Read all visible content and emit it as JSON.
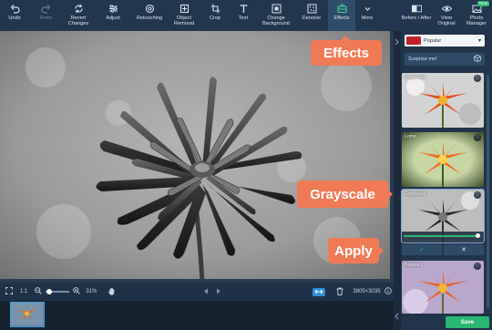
{
  "toolbar": {
    "items": [
      {
        "label": "Undo",
        "icon": "undo-icon"
      },
      {
        "label": "Redo",
        "icon": "redo-icon"
      },
      {
        "label": "Revert Changes",
        "icon": "revert-icon"
      },
      {
        "label": "Adjust",
        "icon": "sliders-icon"
      },
      {
        "label": "Retouching",
        "icon": "retouch-icon"
      },
      {
        "label": "Object Removal",
        "icon": "eraser-icon"
      },
      {
        "label": "Crop",
        "icon": "crop-icon"
      },
      {
        "label": "Text",
        "icon": "text-icon"
      },
      {
        "label": "Change Background",
        "icon": "background-icon"
      },
      {
        "label": "Denoise",
        "icon": "denoise-icon"
      },
      {
        "label": "Effects",
        "icon": "effects-icon"
      },
      {
        "label": "More",
        "icon": "chevron-down-icon"
      }
    ],
    "right_items": [
      {
        "label": "Before / After",
        "icon": "compare-icon"
      },
      {
        "label": "View Original",
        "icon": "eye-icon"
      },
      {
        "label": "Photo Manager",
        "icon": "photo-manager-icon",
        "badge": "New"
      }
    ]
  },
  "bottombar": {
    "ratio": "1:1",
    "zoom": "31%",
    "dimensions": "3805×3035",
    "zoom_level": 0.05
  },
  "panel": {
    "preset_dropdown": "Popular",
    "surprise_label": "Surprise me!",
    "effects": [
      {
        "name": "Grayscale"
      },
      {
        "name": "Lomo"
      },
      {
        "name": "Grayscale"
      },
      {
        "name": "Bonnard"
      }
    ],
    "intensity": 1.0,
    "apply_icon": "✓",
    "cancel_icon": "✕",
    "save_label": "Save"
  },
  "callouts": {
    "effects": "Effects",
    "grayscale": "Grayscale",
    "apply": "Apply"
  },
  "colors": {
    "accent_green": "#2bb673",
    "callout": "#f07a56",
    "toolbar": "#22364d"
  }
}
